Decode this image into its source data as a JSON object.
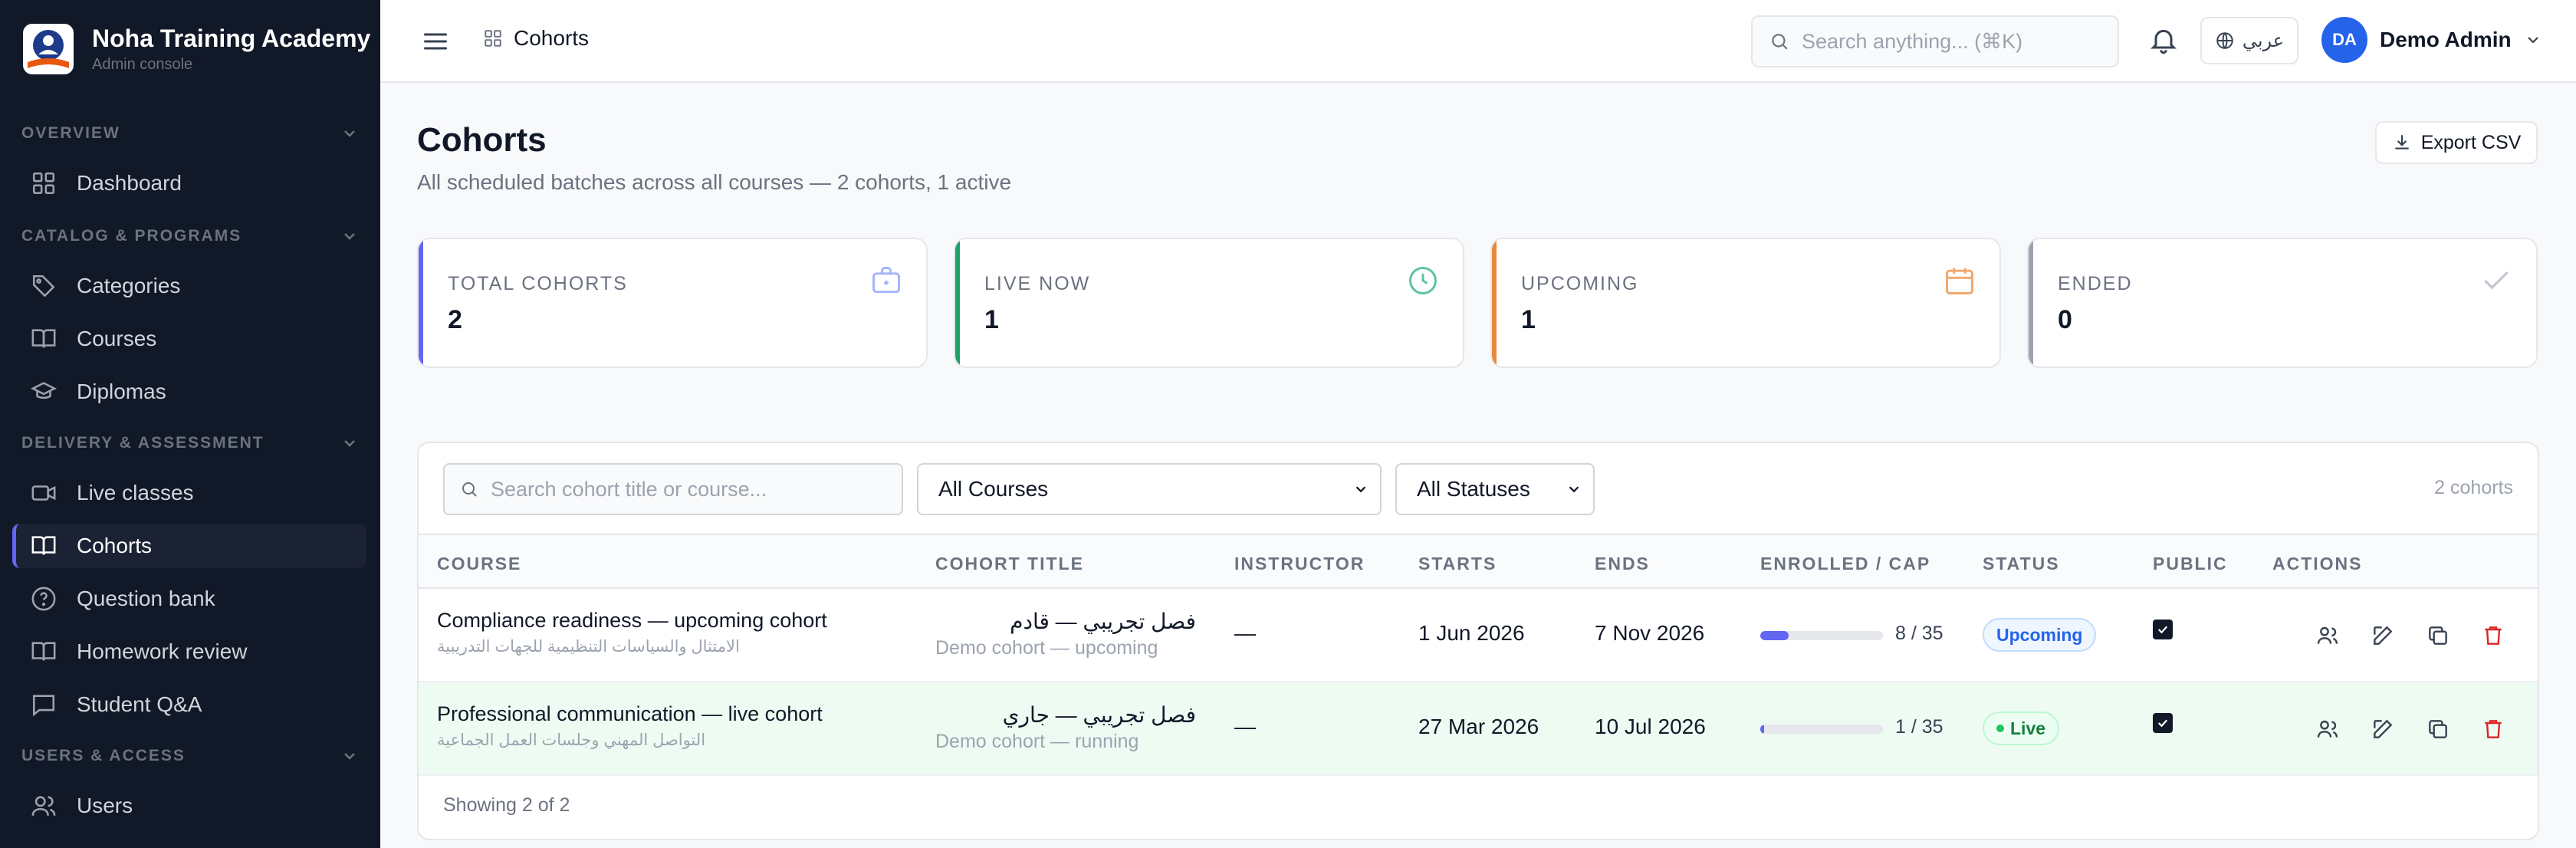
{
  "app": {
    "name": "Noha Training Academy",
    "subtitle": "Admin console"
  },
  "sidebar": {
    "sections": [
      {
        "label": "OVERVIEW",
        "items": [
          {
            "label": "Dashboard",
            "icon": "grid-icon"
          }
        ]
      },
      {
        "label": "CATALOG & PROGRAMS",
        "items": [
          {
            "label": "Categories",
            "icon": "tag-icon"
          },
          {
            "label": "Courses",
            "icon": "book-icon"
          },
          {
            "label": "Diplomas",
            "icon": "graduation-cap-icon"
          }
        ]
      },
      {
        "label": "DELIVERY & ASSESSMENT",
        "items": [
          {
            "label": "Live classes",
            "icon": "video-icon"
          },
          {
            "label": "Cohorts",
            "icon": "book-open-icon",
            "active": true
          },
          {
            "label": "Question bank",
            "icon": "help-circle-icon"
          },
          {
            "label": "Homework review",
            "icon": "book-icon"
          },
          {
            "label": "Student Q&A",
            "icon": "message-icon"
          }
        ]
      },
      {
        "label": "USERS & ACCESS",
        "items": [
          {
            "label": "Users",
            "icon": "users-icon"
          }
        ]
      }
    ]
  },
  "topbar": {
    "breadcrumb": "Cohorts",
    "search_placeholder": "Search anything... (⌘K)",
    "language": "عربي",
    "user_initials": "DA",
    "user_name": "Demo Admin"
  },
  "page": {
    "title": "Cohorts",
    "subtitle": "All scheduled batches across all courses — 2 cohorts, 1 active",
    "export_label": "Export CSV"
  },
  "stats": [
    {
      "label": "TOTAL COHORTS",
      "value": "2",
      "color": "#6366f1",
      "icon": "briefcase-icon"
    },
    {
      "label": "LIVE NOW",
      "value": "1",
      "color": "#22a06b",
      "icon": "clock-icon"
    },
    {
      "label": "UPCOMING",
      "value": "1",
      "color": "#e8893a",
      "icon": "calendar-icon"
    },
    {
      "label": "ENDED",
      "value": "0",
      "color": "#9ca3af",
      "icon": "check-icon"
    }
  ],
  "filters": {
    "search_placeholder": "Search cohort title or course...",
    "course_select": "All Courses",
    "status_select": "All Statuses",
    "count": "2 cohorts"
  },
  "table": {
    "headers": [
      "COURSE",
      "COHORT TITLE",
      "INSTRUCTOR",
      "STARTS",
      "ENDS",
      "ENROLLED / CAP",
      "STATUS",
      "PUBLIC",
      "ACTIONS"
    ],
    "rows": [
      {
        "course": "Compliance readiness — upcoming cohort",
        "course_ar": "الامتثال والسياسات التنظيمية للجهات التدريبية",
        "cohort_ar": "فصل تجريبي — قادم",
        "cohort_en": "Demo cohort — upcoming",
        "instructor": "—",
        "starts": "1 Jun 2026",
        "ends": "7 Nov 2026",
        "enrolled": "8 / 35",
        "enrolled_fraction": 0.23,
        "status": "Upcoming",
        "public": true
      },
      {
        "course": "Professional communication — live cohort",
        "course_ar": "التواصل المهني وجلسات العمل الجماعية",
        "cohort_ar": "فصل تجريبي — جاري",
        "cohort_en": "Demo cohort — running",
        "instructor": "—",
        "starts": "27 Mar 2026",
        "ends": "10 Jul 2026",
        "enrolled": "1 / 35",
        "enrolled_fraction": 0.03,
        "status": "Live",
        "public": true
      }
    ],
    "footer": "Showing 2 of 2"
  },
  "colors": {
    "sidebar_bg": "#111827",
    "accent": "#6366f1",
    "danger": "#dc2626"
  }
}
